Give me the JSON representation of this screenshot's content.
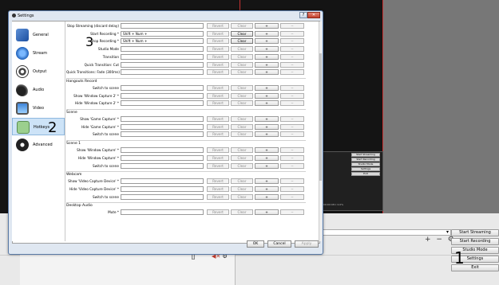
{
  "dialog": {
    "title": "Settings",
    "window_buttons": {
      "help": "?",
      "close": "✕"
    }
  },
  "sidebar": {
    "items": [
      {
        "label": "General",
        "icon": "general-icon"
      },
      {
        "label": "Stream",
        "icon": "stream-globe-icon"
      },
      {
        "label": "Output",
        "icon": "output-icon"
      },
      {
        "label": "Audio",
        "icon": "audio-speaker-icon"
      },
      {
        "label": "Video",
        "icon": "video-monitor-icon"
      },
      {
        "label": "Hotkeys",
        "icon": "hotkeys-keyboard-icon",
        "selected": true
      },
      {
        "label": "Advanced",
        "icon": "advanced-gears-icon"
      }
    ]
  },
  "hotkey_buttons": {
    "revert": "Revert",
    "clear": "Clear",
    "add": "+",
    "remove": "−"
  },
  "rows": [
    {
      "label": "Stop Streaming (discard delay)",
      "value": "",
      "revert_active": false,
      "clear_active": false
    },
    {
      "label": "Start Recording *",
      "value": "Shift + Num +",
      "clear_active": true
    },
    {
      "label": "Stop Recording *",
      "value": "Shift + Num +",
      "clear_active": true
    },
    {
      "label": "Studio Mode",
      "value": ""
    },
    {
      "label": "Transition",
      "value": ""
    },
    {
      "label": "Quick Transition: Cut",
      "value": ""
    },
    {
      "label": "Quick Transitions: Fade (300ms)",
      "value": ""
    }
  ],
  "sections": [
    {
      "title": "Hangouts Record",
      "rows": [
        {
          "label": "Switch to scene",
          "value": ""
        },
        {
          "label": "Show 'Window Capture 2' *",
          "value": ""
        },
        {
          "label": "Hide 'Window Capture 2' *",
          "value": ""
        }
      ]
    },
    {
      "title": "Scene",
      "rows": [
        {
          "label": "Show 'Game Capture' *",
          "value": ""
        },
        {
          "label": "Hide 'Game Capture' *",
          "value": ""
        },
        {
          "label": "Switch to scene",
          "value": ""
        }
      ]
    },
    {
      "title": "Scene 1",
      "rows": [
        {
          "label": "Show 'Window Capture' *",
          "value": ""
        },
        {
          "label": "Hide 'Window Capture' *",
          "value": ""
        },
        {
          "label": "Switch to scene",
          "value": ""
        }
      ]
    },
    {
      "title": "Webcam",
      "rows": [
        {
          "label": "Show 'Video Capture Device' *",
          "value": ""
        },
        {
          "label": "Hide 'Video Capture Device' *",
          "value": ""
        },
        {
          "label": "Switch to scene",
          "value": ""
        }
      ]
    },
    {
      "title": "Desktop Audio",
      "rows": [
        {
          "label": "Mute *",
          "value": ""
        }
      ]
    }
  ],
  "footer": {
    "ok": "OK",
    "cancel": "Cancel",
    "apply": "Apply"
  },
  "annotations": {
    "n1": "1",
    "n2": "2",
    "n3": "3"
  },
  "main_window": {
    "controls": [
      "Start Streaming",
      "Start Recording",
      "Studio Mode",
      "Settings",
      "Exit"
    ],
    "inner_controls": [
      "Start Streaming",
      "Start Recording",
      "Studio Mode",
      "Settings",
      "Exit"
    ],
    "inner_status": "00:00:00   CPU: 0.0%",
    "plus_minus": "+ − ⚙"
  },
  "colors": {
    "dialog_frame": "#5a7aa6",
    "selection": "#cde3f7",
    "preview_border": "#c93333"
  }
}
